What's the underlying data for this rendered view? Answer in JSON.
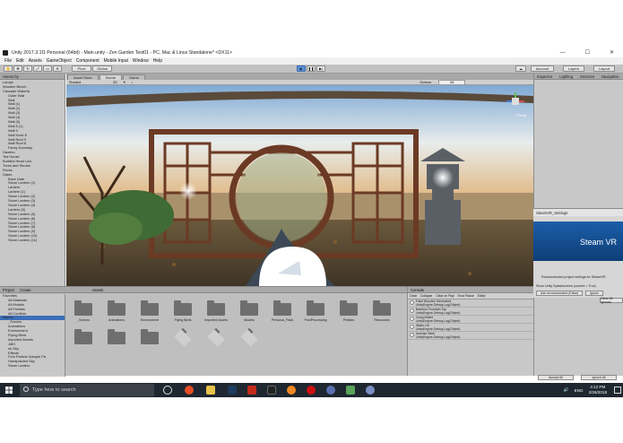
{
  "window": {
    "title": "Unity 2017.3.1f1 Personal (64bit) - Main.unity - Zen Garden Test01 - PC, Mac & Linux Standalone* <DX11>",
    "minimize": "—",
    "maximize": "☐",
    "close": "✕"
  },
  "menu": [
    "File",
    "Edit",
    "Assets",
    "GameObject",
    "Component",
    "Mobile Input",
    "Window",
    "Help"
  ],
  "toolbar": {
    "pivot": "Pivot",
    "global": "Global",
    "account": "Account",
    "layers": "Layers",
    "layout": "Layout"
  },
  "hierarchy": {
    "tab": "Hierarchy",
    "items": [
      "Lamps",
      "Wooden Bench",
      "Cascade Waterfa",
      "Outer Wall",
      "Wall",
      "Wall (1)",
      "Wall (2)",
      "Wall (3)",
      "Wall (4)",
      "Wall (5)",
      "Wall 8 (1)",
      "Wall 9",
      "Wall Knob 8",
      "Wall Roof 9",
      "Wall Roof 8",
      "Fancy Doorway",
      "Gazebo",
      "Tea House",
      "Buddha Head Low",
      "Trees and Shrubs",
      "Rocks",
      "Gates",
      "Back Gate",
      "Stone Lantern (1)",
      "Lantern",
      "Lantern (1)",
      "Stone Lantern (2)",
      "Stone Lantern (3)",
      "Stone Lantern (4)",
      "Lantern (6)",
      "Stone Lantern (5)",
      "Stone Lantern (6)",
      "Stone Lantern (7)",
      "Stone Lantern (8)",
      "Stone Lantern (9)",
      "Stone Lantern (10)",
      "Stone Lantern (11)"
    ]
  },
  "scene": {
    "tabs": [
      "Asset Store",
      "Scene",
      "Game"
    ],
    "shaded": "Shaded",
    "gizmos": "Gizmos",
    "search_placeholder": "All",
    "persp_label": "< Persp"
  },
  "inspector": {
    "tabs": [
      "Inspector",
      "Lighting",
      "Services",
      "Navigation"
    ]
  },
  "steamvr": {
    "window_title": "SteamVR_Settings",
    "logo_text": "Steam VR",
    "recommended": "Recommended project settings for SteamVR:",
    "show_prompt": "Show Unity Splashscreen (current = True)",
    "use_recommended": "Use recommended (False)",
    "ignore": "Ignore",
    "clear_all": "Clear All Ignores",
    "accept_all": "Accept All",
    "ignore_all": "Ignore All"
  },
  "project": {
    "tabs": [
      "Project"
    ],
    "create": "Create",
    "tree": [
      "Favorites",
      "All Materials",
      "All Models",
      "All Prefabs",
      "All Conflicts",
      "Assets",
      "_Scenes",
      "Animations",
      "Environment",
      "Flying Birds",
      "Imported Assets",
      "JMO",
      "mi-Sky",
      "Effects",
      "Fork Particle Sample Pa",
      "Handpainted Sky",
      "Stone Lantern"
    ],
    "breadcrumb": "Assets",
    "assets": [
      {
        "name": "_Scenes",
        "kind": "folder"
      },
      {
        "name": "Animations",
        "kind": "folder"
      },
      {
        "name": "Environment",
        "kind": "folder"
      },
      {
        "name": "Flying Birds",
        "kind": "folder"
      },
      {
        "name": "Imported Assets",
        "kind": "folder"
      },
      {
        "name": "Models",
        "kind": "folder"
      },
      {
        "name": "Personal_Pack",
        "kind": "folder"
      },
      {
        "name": "PostProcessing",
        "kind": "folder"
      },
      {
        "name": "Prefabs",
        "kind": "folder"
      },
      {
        "name": "Resources",
        "kind": "folder"
      },
      {
        "name": "",
        "kind": "folder"
      },
      {
        "name": "",
        "kind": "folder"
      },
      {
        "name": "",
        "kind": "folder"
      },
      {
        "name": "",
        "kind": "cube"
      },
      {
        "name": "",
        "kind": "cube"
      },
      {
        "name": "",
        "kind": "cube"
      }
    ]
  },
  "console": {
    "tab": "Console",
    "buttons": [
      "Clear",
      "Collapse",
      "Clear on Play",
      "Error Pause",
      "Editor"
    ],
    "entries": [
      {
        "title": "Fake Wooden Generated",
        "sub": "UnityEngine.Debug:Log(Object)"
      },
      {
        "title": "Bamboo Fountain Top",
        "sub": "UnityEngine.Debug:Log(Object)"
      },
      {
        "title": "Gong Mallet",
        "sub": "UnityEngine.Debug:Log(Object)"
      },
      {
        "title": "Water Lilt",
        "sub": "UnityEngine.Debug:Log(Object)"
      },
      {
        "title": "Incense Stick",
        "sub": "UnityEngine.Debug:Log(Object)"
      }
    ]
  },
  "taskbar": {
    "search_placeholder": "Type here to search",
    "time": "4:12 PM",
    "date": "2/26/2018",
    "lang": "ENG"
  },
  "colors": {
    "sky_top": "#7fa9d4",
    "taskbar": "#1f2730",
    "steamvr_blue": "#1c5ea8",
    "unity_grey": "#c8c8c8"
  }
}
